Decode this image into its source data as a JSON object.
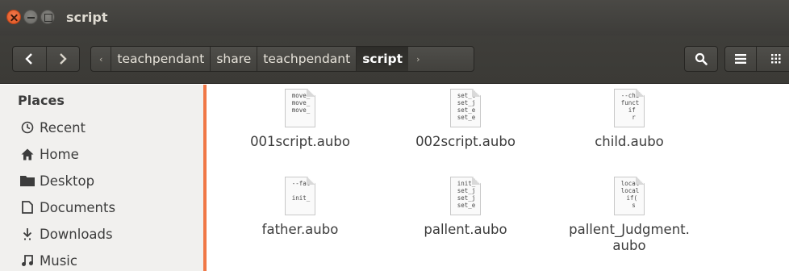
{
  "window": {
    "title": "script"
  },
  "toolbar": {
    "back_label": "<",
    "forward_label": ">",
    "path": [
      "teachpendant",
      "share",
      "teachpendant",
      "script"
    ],
    "path_left_arrow": "‹",
    "path_right_arrow": "›"
  },
  "sidebar": {
    "header": "Places",
    "items": [
      {
        "label": "Recent",
        "icon": "clock-icon"
      },
      {
        "label": "Home",
        "icon": "home-icon"
      },
      {
        "label": "Desktop",
        "icon": "folder-icon"
      },
      {
        "label": "Documents",
        "icon": "document-icon"
      },
      {
        "label": "Downloads",
        "icon": "download-icon"
      },
      {
        "label": "Music",
        "icon": "music-icon"
      }
    ]
  },
  "files": [
    {
      "name": "001script.aubo",
      "preview": "move_\nmove_\nmove_"
    },
    {
      "name": "002script.aubo",
      "preview": "set_t\nset_j\nset_e\nset_e"
    },
    {
      "name": "child.aubo",
      "preview": "--chi\nfunct\n if\n  r"
    },
    {
      "name": "father.aubo",
      "preview": "--fat\n\ninit_"
    },
    {
      "name": "pallent.aubo",
      "preview": "init_\nset_j\nset_j\nset_e"
    },
    {
      "name": "pallent_Judgment.\naubo",
      "preview": "local\nlocal\n if(\n  s"
    }
  ],
  "colors": {
    "accent": "#f07746",
    "titlebar": "#3d3c39",
    "sidebar_bg": "#f1f0ee"
  }
}
